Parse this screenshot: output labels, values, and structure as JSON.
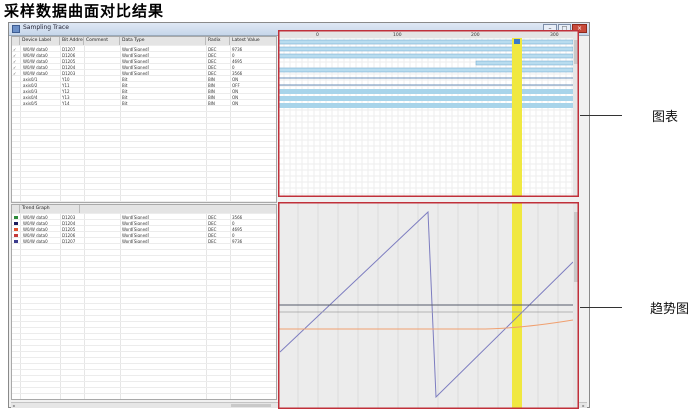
{
  "caption": "采样数据曲面对比结果",
  "window": {
    "title": "Sampling Trace",
    "controls": [
      "–",
      "□",
      "×"
    ]
  },
  "upper_grid": {
    "columns": [
      "Device Label",
      "Bit Address",
      "Comment",
      "Data Type",
      "Radix",
      "Latest Value"
    ],
    "timeline_ticks": [
      "0",
      "100",
      "200",
      "300"
    ],
    "rows": [
      {
        "check": "✓",
        "device": "W0/W data0",
        "addr": "D1207",
        "dtype": "Word[Signed]",
        "radix": "DEC",
        "value": "9736"
      },
      {
        "check": "✓",
        "device": "W0/W data0",
        "addr": "D1206",
        "dtype": "Word[Signed]",
        "radix": "DEC",
        "value": "0"
      },
      {
        "check": "✓",
        "device": "W0/W data0",
        "addr": "D1205",
        "dtype": "Word[Signed]",
        "radix": "DEC",
        "value": "4695"
      },
      {
        "check": "✓",
        "device": "W0/W data0",
        "addr": "D1204",
        "dtype": "Word[Signed]",
        "radix": "DEC",
        "value": "0"
      },
      {
        "check": "✓",
        "device": "W0/W data0",
        "addr": "D1203",
        "dtype": "Word[Signed]",
        "radix": "DEC",
        "value": "3566"
      },
      {
        "check": "",
        "device": "axis0/1",
        "addr": "Y10",
        "dtype": "Bit",
        "radix": "BIN",
        "value": "ON"
      },
      {
        "check": "",
        "device": "axis0/2",
        "addr": "Y11",
        "dtype": "Bit",
        "radix": "BIN",
        "value": "OFF"
      },
      {
        "check": "",
        "device": "axis0/3",
        "addr": "Y12",
        "dtype": "Bit",
        "radix": "BIN",
        "value": "ON"
      },
      {
        "check": "",
        "device": "axis0/4",
        "addr": "Y13",
        "dtype": "Bit",
        "radix": "BIN",
        "value": "ON"
      },
      {
        "check": "",
        "device": "axis0/5",
        "addr": "Y14",
        "dtype": "Bit",
        "radix": "BIN",
        "value": "ON"
      }
    ]
  },
  "lower_grid": {
    "header_label": "Trend Graph",
    "rows": [
      {
        "color": "#2e8b3a",
        "device": "W0/W data0",
        "addr": "D1203",
        "dtype": "Word[Signed]",
        "radix": "DEC",
        "value": "3566"
      },
      {
        "color": "#1c1c5c",
        "device": "W0/W data0",
        "addr": "D1204",
        "dtype": "Word[Signed]",
        "radix": "DEC",
        "value": "0"
      },
      {
        "color": "#e0502c",
        "device": "W0/W data0",
        "addr": "D1205",
        "dtype": "Word[Signed]",
        "radix": "DEC",
        "value": "4695"
      },
      {
        "color": "#c43a3a",
        "device": "W0/W data0",
        "addr": "D1206",
        "dtype": "Word[Signed]",
        "radix": "DEC",
        "value": "0"
      },
      {
        "color": "#3a3a8c",
        "device": "W0/W data0",
        "addr": "D1207",
        "dtype": "Word[Signed]",
        "radix": "DEC",
        "value": "9736"
      }
    ]
  },
  "annotations": {
    "chart_label": "图表",
    "trend_label": "趋势图"
  },
  "colors": {
    "highlight_frame": "#c0303a",
    "cursor": "#f0e840",
    "bar_fill": "#b8dcef",
    "trace_blue": "#7d7dc0",
    "trace_orange": "#f0a070",
    "trace_dark": "#555a6a"
  }
}
